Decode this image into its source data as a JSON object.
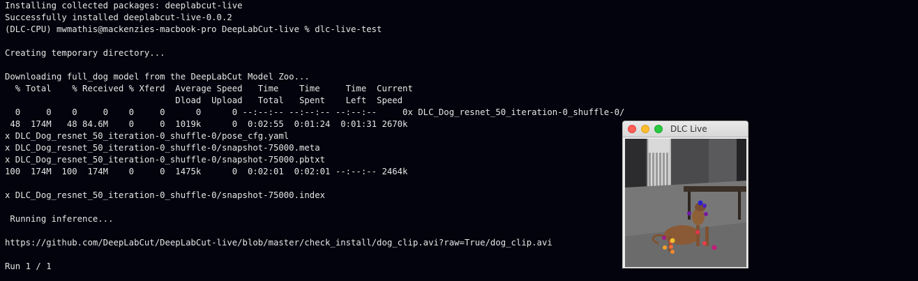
{
  "terminal": {
    "lines": [
      "Installing collected packages: deeplabcut-live",
      "Successfully installed deeplabcut-live-0.0.2",
      "(DLC-CPU) mwmathis@mackenzies-macbook-pro DeepLabCut-live % dlc-live-test",
      "",
      "Creating temporary directory...",
      "",
      "Downloading full_dog model from the DeepLabCut Model Zoo...",
      "  % Total    % Received % Xferd  Average Speed   Time    Time     Time  Current",
      "                                 Dload  Upload   Total   Spent    Left  Speed",
      "  0     0    0     0    0     0      0      0 --:--:-- --:--:-- --:--:--     0x DLC_Dog_resnet_50_iteration-0_shuffle-0/",
      " 48  174M   48 84.6M    0     0  1019k      0  0:02:55  0:01:24  0:01:31 2670k",
      "x DLC_Dog_resnet_50_iteration-0_shuffle-0/pose_cfg.yaml",
      "x DLC_Dog_resnet_50_iteration-0_shuffle-0/snapshot-75000.meta",
      "x DLC_Dog_resnet_50_iteration-0_shuffle-0/snapshot-75000.pbtxt",
      "100  174M  100  174M    0     0  1475k      0  0:02:01  0:02:01 --:--:-- 2464k",
      "",
      "x DLC_Dog_resnet_50_iteration-0_shuffle-0/snapshot-75000.index",
      "",
      " Running inference...",
      "",
      "https://github.com/DeepLabCut/DeepLabCut-live/blob/master/check_install/dog_clip.avi?raw=True/dog_clip.avi",
      "",
      "Run 1 / 1"
    ]
  },
  "dlc_window": {
    "title": "DLC Live",
    "keypoint_colors": [
      "#2a1fd0",
      "#6a1aa8",
      "#a01a8a",
      "#d11e6a",
      "#ee3b4a",
      "#f26b3a",
      "#f7a02a",
      "#f0c030"
    ]
  }
}
